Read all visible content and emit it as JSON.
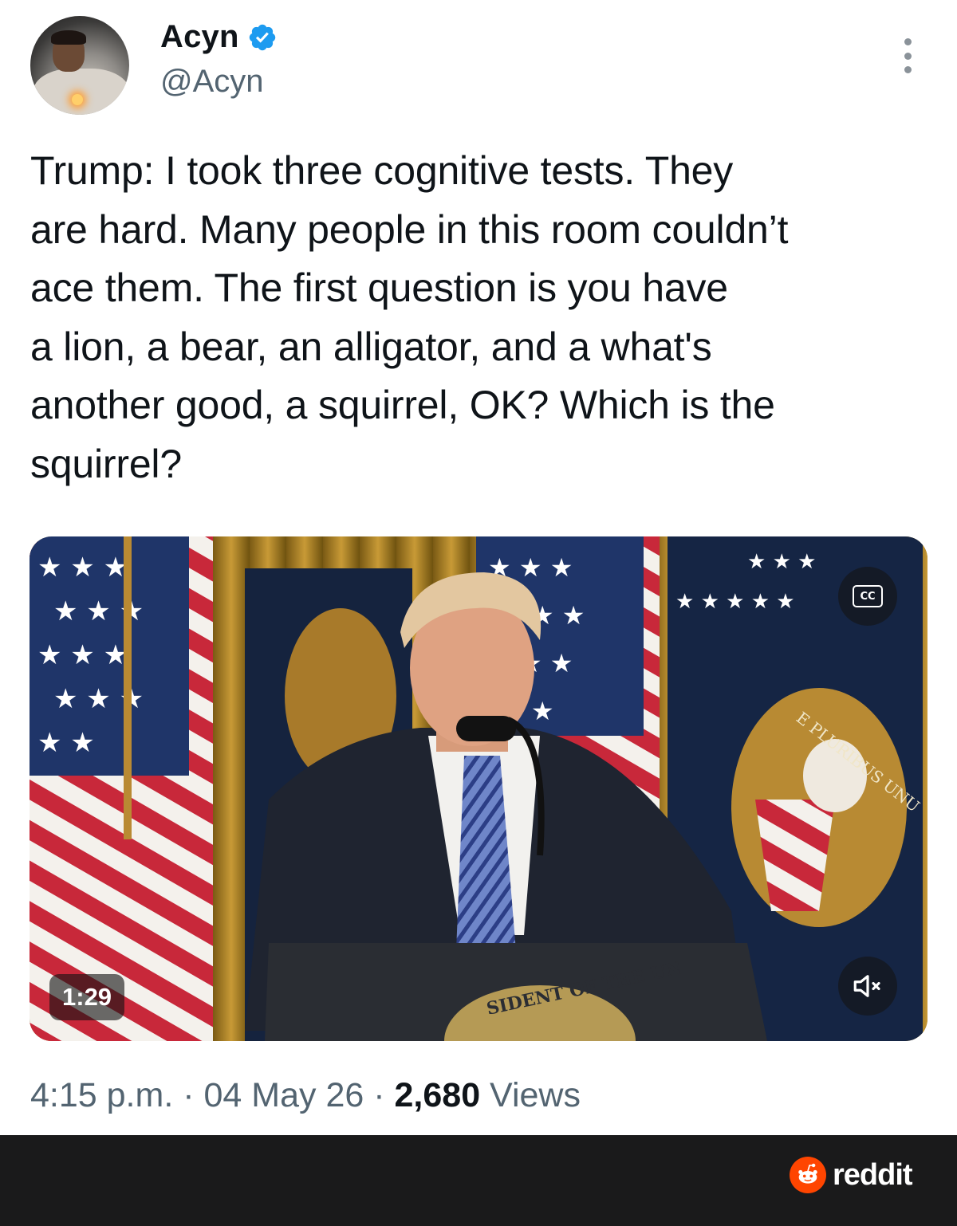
{
  "author": {
    "display_name": "Acyn",
    "handle": "@Acyn",
    "verified": true,
    "verified_color": "#1d9bf0"
  },
  "menu_icon": "more-vertical-icon",
  "tweet": {
    "text": "Trump: I took three cognitive tests. They\nare hard. Many people in this room couldn’t\nace them. The first question is you have\na lion, a bear, an alligator, and a what's\nanother good, a squirrel, OK? Which is the\nsquirrel?"
  },
  "video": {
    "duration": "1:29",
    "captions_icon": "cc-icon",
    "captions_label": "CC",
    "mute_icon": "muted-speaker-icon",
    "podium_text": "SIDENT OF THE UN",
    "flag_text": "E PLURIBUS UNU"
  },
  "meta": {
    "time": "4:15 p.m.",
    "separator": " · ",
    "date": "04 May 26",
    "views_count": "2,680",
    "views_label": " Views"
  },
  "footer": {
    "brand": "reddit",
    "brand_icon": "reddit-snoo-icon",
    "brand_color": "#ff4500",
    "background": "#1a1a1b"
  }
}
